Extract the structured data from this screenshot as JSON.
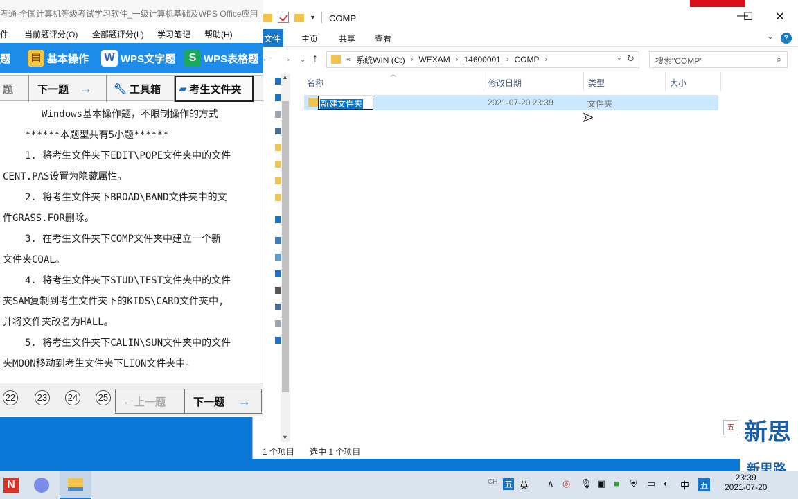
{
  "explorer": {
    "title": "COMP",
    "ribbon_tabs": [
      "文件",
      "主页",
      "共享",
      "查看"
    ],
    "address": [
      "系统WIN (C:)",
      "WEXAM",
      "14600001",
      "COMP"
    ],
    "address_prefix": "«",
    "search_placeholder": "搜索\"COMP\"",
    "columns": [
      "名称",
      "修改日期",
      "类型",
      "大小"
    ],
    "rows": [
      {
        "name": "新建文件夹",
        "modified": "2021-07-20 23:39",
        "type": "文件夹",
        "size": ""
      }
    ],
    "status_count": "1 个项目",
    "status_selected": "选中 1 个项目"
  },
  "exam": {
    "title": "考通-全国计算机等级考试学习软件_一级计算机基础及WPS Office应用",
    "menu": [
      "件",
      "当前题评分(O)",
      "全部题评分(L)",
      "学习笔记",
      "帮助(H)"
    ],
    "toolbar": [
      "题",
      "基本操作",
      "WPS文字题",
      "WPS表格题"
    ],
    "nav": {
      "prev_partial": "题",
      "next": "下一题",
      "tools": "工具箱",
      "folder": "考生文件夹"
    },
    "body_lines": [
      "Windows基本操作题，不限制操作的方式",
      "******本题型共有5小题******",
      "1. 将考生文件夹下EDIT\\POPE文件夹中的文件",
      "CENT.PAS设置为隐藏属性。",
      "2. 将考生文件夹下BROAD\\BAND文件夹中的文",
      "件GRASS.FOR删除。",
      "3. 在考生文件夹下COMP文件夹中建立一个新",
      "文件夹COAL。",
      "4. 将考生文件夹下STUD\\TEST文件夹中的文件",
      "夹SAM复制到考生文件夹下的KIDS\\CARD文件夹中,",
      "并将文件夹改名为HALL。",
      "5. 将考生文件夹下CALIN\\SUN文件夹中的文件",
      "夹MOON移动到考生文件夹下LION文件夹中。"
    ],
    "question_numbers": [
      "22",
      "23",
      "24",
      "25"
    ],
    "prev_button": "上一题",
    "next_button": "下一题"
  },
  "logo": {
    "big": "新思",
    "small": "新思路"
  },
  "ime_box": "五",
  "taskbar": {
    "tray": [
      "CH",
      "五",
      "英",
      "中",
      "五"
    ],
    "time": "23:39",
    "date": "2021-07-20"
  }
}
